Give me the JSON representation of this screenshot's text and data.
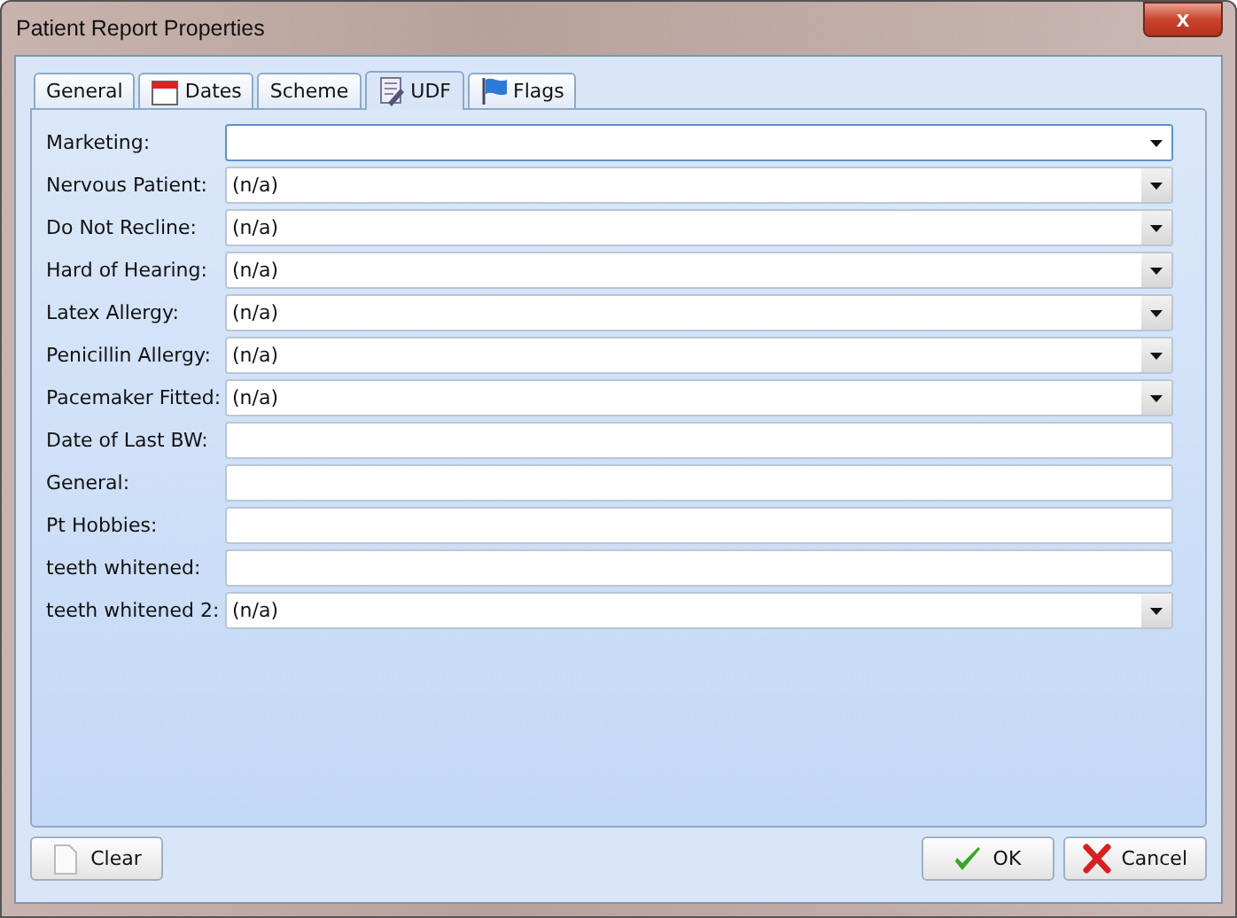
{
  "window": {
    "title": "Patient Report Properties",
    "close": "x"
  },
  "tabs": [
    {
      "label": "General",
      "selected": false
    },
    {
      "label": "Dates",
      "selected": false
    },
    {
      "label": "Scheme",
      "selected": false
    },
    {
      "label": "UDF",
      "selected": true
    },
    {
      "label": "Flags",
      "selected": false
    }
  ],
  "fields": [
    {
      "label": "Marketing:",
      "kind": "dropdown",
      "focused": true
    },
    {
      "label": "Nervous Patient:",
      "kind": "dropdown",
      "value": "(n/a)",
      "focused": false
    },
    {
      "label": "Do Not Recline:",
      "kind": "dropdown",
      "value": "(n/a)",
      "focused": false
    },
    {
      "label": "Hard of Hearing:",
      "kind": "dropdown",
      "value": "(n/a)",
      "focused": false
    },
    {
      "label": "Latex Allergy:",
      "kind": "dropdown",
      "value": "(n/a)",
      "focused": false
    },
    {
      "label": "Penicillin Allergy:",
      "kind": "dropdown",
      "value": "(n/a)",
      "focused": false
    },
    {
      "label": "Pacemaker Fitted:",
      "kind": "dropdown",
      "value": "(n/a)",
      "focused": false
    },
    {
      "label": "Date of Last BW:",
      "kind": "text",
      "focused": false
    },
    {
      "label": "General:",
      "kind": "text",
      "focused": false
    },
    {
      "label": "Pt Hobbies:",
      "kind": "text",
      "focused": false
    },
    {
      "label": "teeth whitened:",
      "kind": "text",
      "focused": false
    },
    {
      "label": "teeth whitened 2:",
      "kind": "dropdown",
      "value": "(n/a)",
      "focused": false
    }
  ],
  "buttons": [
    {
      "label": "Clear"
    },
    {
      "label": "OK"
    },
    {
      "label": "Cancel"
    }
  ]
}
